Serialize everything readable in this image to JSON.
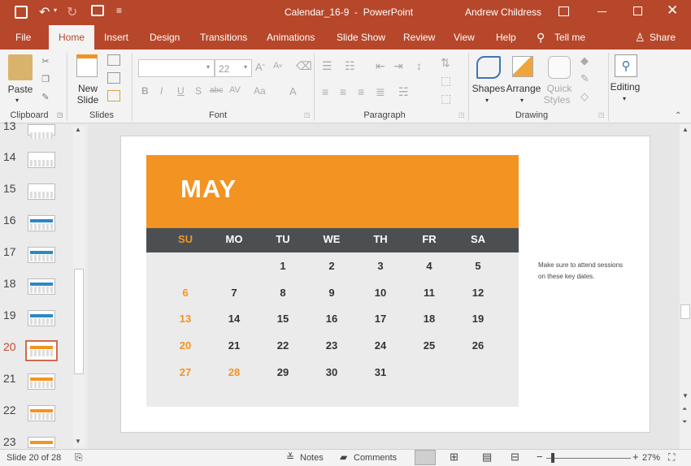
{
  "window": {
    "title": "Calendar_16-9  -  PowerPoint",
    "user": "Andrew Childress"
  },
  "tabs": [
    "File",
    "Home",
    "Insert",
    "Design",
    "Transitions",
    "Animations",
    "Slide Show",
    "Review",
    "View",
    "Help"
  ],
  "tell_me": "Tell me",
  "share": "Share",
  "ribbon": {
    "paste": "Paste",
    "new_slide_1": "New",
    "new_slide_2": "Slide",
    "font_size": "22",
    "shapes": "Shapes",
    "arrange": "Arrange",
    "quick_styles_1": "Quick",
    "quick_styles_2": "Styles",
    "editing": "Editing",
    "groups": {
      "clipboard": "Clipboard",
      "slides": "Slides",
      "font": "Font",
      "paragraph": "Paragraph",
      "drawing": "Drawing"
    }
  },
  "thumbnails": [
    {
      "num": "13",
      "style": "blank"
    },
    {
      "num": "14",
      "style": "blank"
    },
    {
      "num": "15",
      "style": "blank"
    },
    {
      "num": "16",
      "style": "blue"
    },
    {
      "num": "17",
      "style": "blue"
    },
    {
      "num": "18",
      "style": "blue"
    },
    {
      "num": "19",
      "style": "blue"
    },
    {
      "num": "20",
      "style": "orange",
      "selected": true
    },
    {
      "num": "21",
      "style": "orange"
    },
    {
      "num": "22",
      "style": "orange"
    },
    {
      "num": "23",
      "style": "orange"
    }
  ],
  "calendar": {
    "month": "MAY",
    "days": [
      "SU",
      "MO",
      "TU",
      "WE",
      "TH",
      "FR",
      "SA"
    ],
    "weeks": [
      [
        "",
        "",
        "1",
        "2",
        "3",
        "4",
        "5"
      ],
      [
        "6",
        "7",
        "8",
        "9",
        "10",
        "11",
        "12"
      ],
      [
        "13",
        "14",
        "15",
        "16",
        "17",
        "18",
        "19"
      ],
      [
        "20",
        "21",
        "22",
        "23",
        "24",
        "25",
        "26"
      ],
      [
        "27",
        "28",
        "29",
        "30",
        "31",
        "",
        ""
      ]
    ],
    "highlighted": [
      "6",
      "13",
      "20",
      "27",
      "28"
    ],
    "note_line1": "Make sure to attend sessions",
    "note_line2": "on these key dates."
  },
  "status": {
    "slide_info": "Slide 20 of 28",
    "notes": "Notes",
    "comments": "Comments",
    "zoom": "27%"
  },
  "colors": {
    "accent": "#b7472a",
    "calendar_orange": "#f39422",
    "calendar_dark": "#4b4f52",
    "calendar_body": "#ebebeb"
  }
}
